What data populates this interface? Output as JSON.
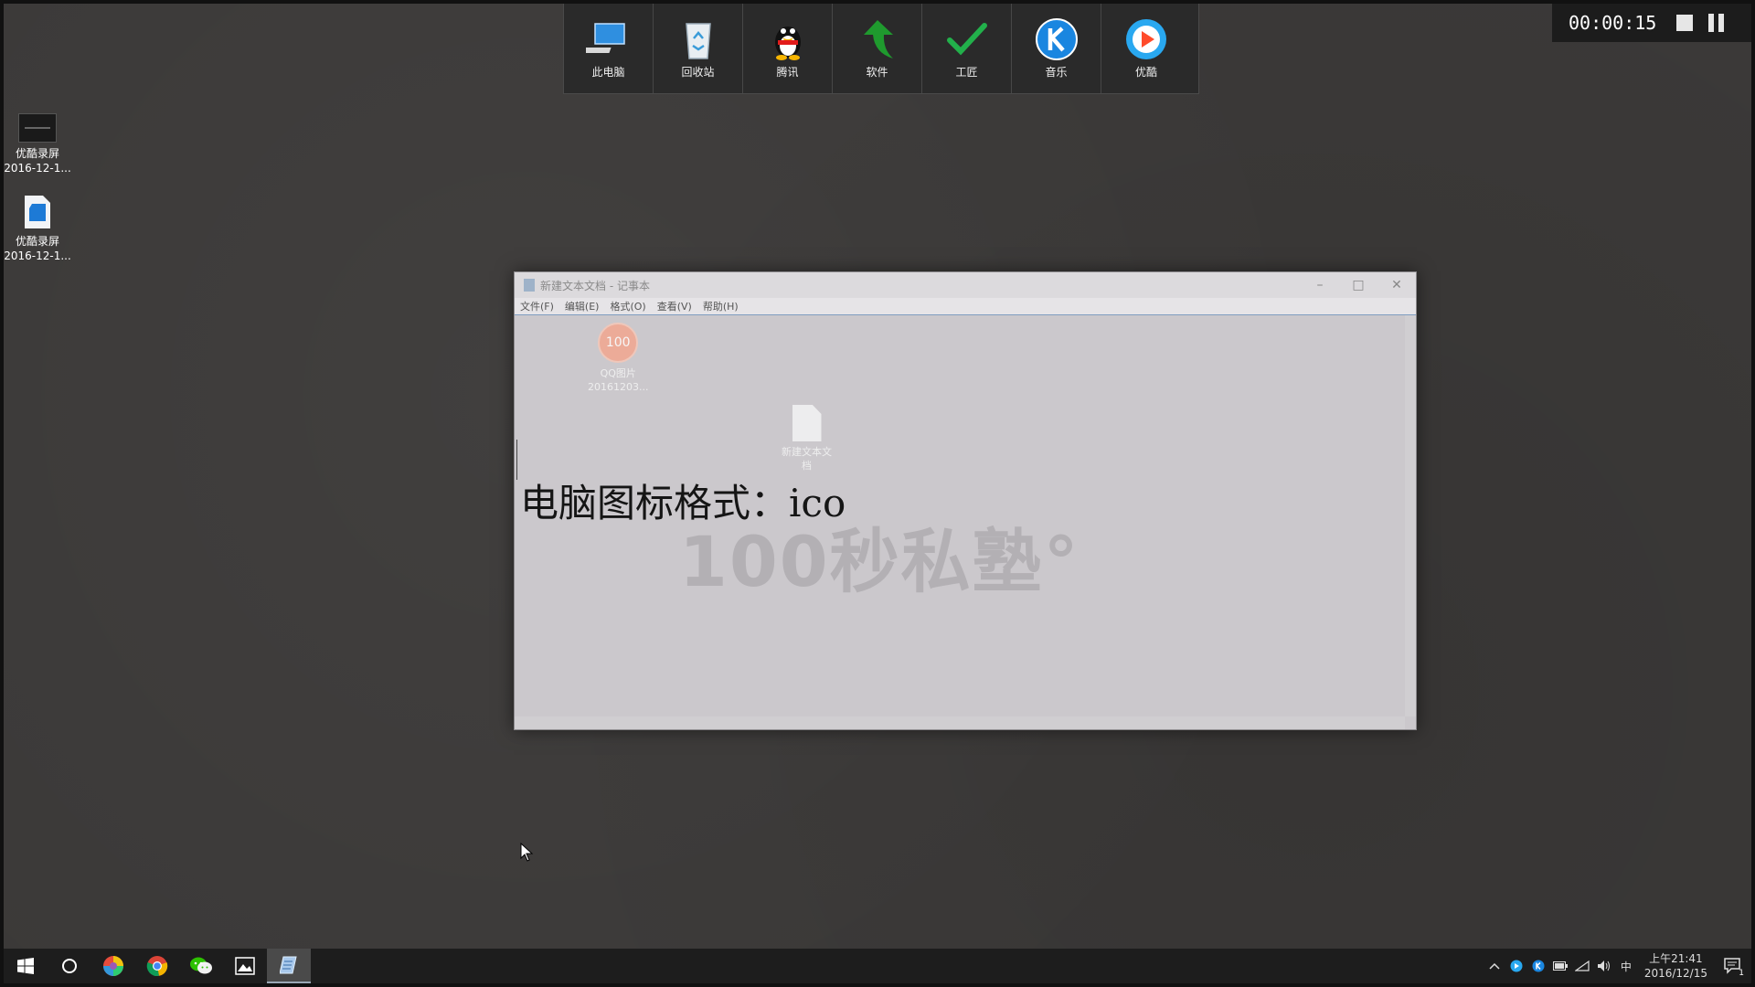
{
  "dock": {
    "items": [
      {
        "label": "此电脑",
        "icon": "computer-icon"
      },
      {
        "label": "回收站",
        "icon": "recycle-bin-icon"
      },
      {
        "label": "腾讯",
        "icon": "qq-penguin-icon"
      },
      {
        "label": "软件",
        "icon": "green-arrow-icon"
      },
      {
        "label": "工匠",
        "icon": "checkmark-icon"
      },
      {
        "label": "音乐",
        "icon": "kugou-music-icon"
      },
      {
        "label": "优酷",
        "icon": "youku-play-icon"
      }
    ]
  },
  "recorder": {
    "timer": "00:00:15",
    "stop_icon": "stop-icon",
    "pause_icon": "pause-icon"
  },
  "desktop": {
    "icons": [
      {
        "line1": "优酷录屏",
        "line2": "2016-12-1..."
      },
      {
        "line1": "优酷录屏",
        "line2": "2016-12-1..."
      }
    ]
  },
  "notepad": {
    "title": "新建文本文档 - 记事本",
    "menus": [
      "文件(F)",
      "编辑(E)",
      "格式(O)",
      "查看(V)",
      "帮助(H)"
    ],
    "content": "电脑图标格式：ico",
    "watermark": "100秒私塾°",
    "overlay_icons": [
      {
        "badge": "100",
        "line1": "QQ图片",
        "line2": "20161203..."
      },
      {
        "line1": "新建文本文",
        "line2": "档"
      }
    ],
    "controls": {
      "minimize": "–",
      "maximize": "□",
      "close": "✕"
    }
  },
  "taskbar": {
    "apps": [
      "start-icon",
      "cortana-search-icon",
      "color-browser-icon",
      "chrome-icon",
      "wechat-icon",
      "photos-icon",
      "notepad-icon"
    ],
    "tray": {
      "ime": "中",
      "time": "上午21:41",
      "date": "2016/12/15",
      "notification_count": "1"
    }
  },
  "colors": {
    "desktop_bg": "#3b3938",
    "dock_bg": "#2a2a2a",
    "taskbar_bg": "#1d1d1d",
    "notepad_bg": "#cbc8cc"
  }
}
